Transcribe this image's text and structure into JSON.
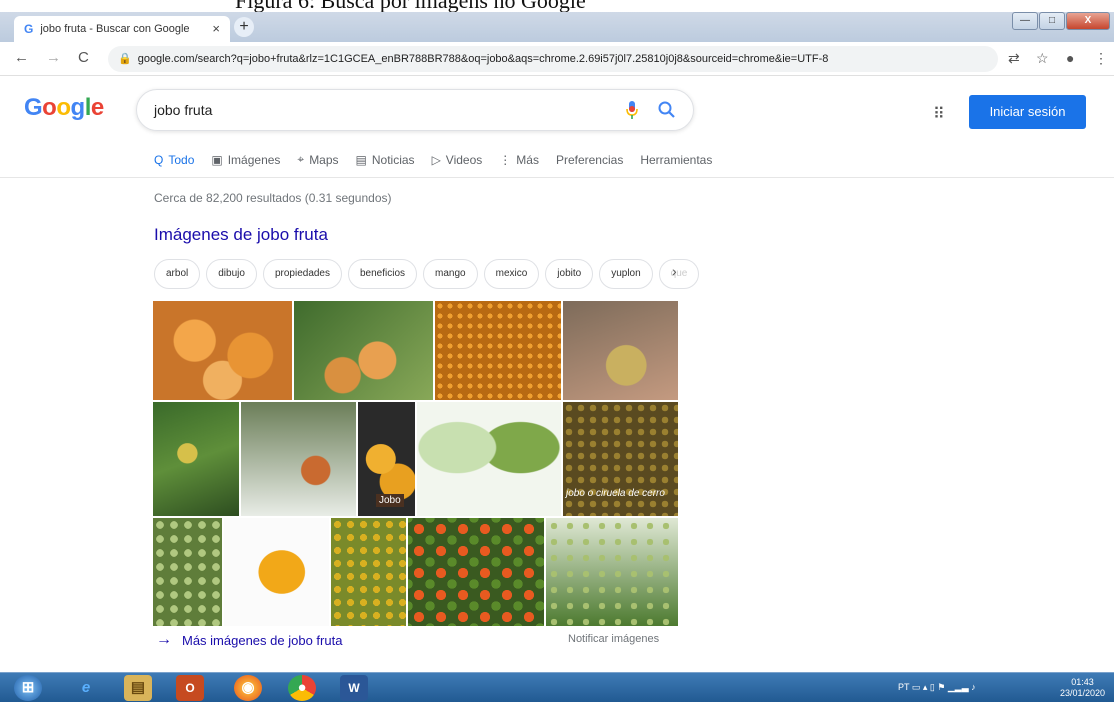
{
  "caption": "Figura 6: Busca por imagens no Google",
  "browser": {
    "tab_title": "jobo fruta - Buscar con Google",
    "tab_close": "×",
    "new_tab": "+",
    "url": "google.com/search?q=jobo+fruta&rlz=1C1GCEA_enBR788BR788&oq=jobo&aqs=chrome.2.69i57j0l7.25810j0j8&sourceid=chrome&ie=UTF-8",
    "nav": {
      "back": "←",
      "forward": "→",
      "reload": "C"
    },
    "window": {
      "min": "—",
      "max": "□",
      "close": "X"
    }
  },
  "google": {
    "logo": [
      "G",
      "o",
      "o",
      "g",
      "l",
      "e"
    ],
    "query": "jobo fruta",
    "signin": "Iniciar sesión",
    "tabs": [
      {
        "label": "Todo",
        "icon": "Q"
      },
      {
        "label": "Imágenes",
        "icon": "▣"
      },
      {
        "label": "Maps",
        "icon": "⌖"
      },
      {
        "label": "Noticias",
        "icon": "▤"
      },
      {
        "label": "Videos",
        "icon": "▷"
      },
      {
        "label": "Más",
        "icon": "⋮"
      },
      {
        "label": "Preferencias",
        "icon": ""
      },
      {
        "label": "Herramientas",
        "icon": ""
      }
    ],
    "stats": "Cerca de 82,200 resultados (0.31 segundos)",
    "images_heading": "Imágenes de jobo fruta",
    "chips": [
      "arbol",
      "dibujo",
      "propiedades",
      "beneficios",
      "mango",
      "mexico",
      "jobito",
      "yuplon",
      "que"
    ],
    "image_captions": [
      "Jobo",
      "jobo o ciruela de cerro"
    ],
    "more_images": "Más imágenes de jobo fruta",
    "report_images": "Notificar imágenes"
  },
  "taskbar": {
    "language": "PT",
    "time": "01:43",
    "date": "23/01/2020"
  },
  "colors": {
    "accent": "#1a73e8",
    "link": "#1a0dab",
    "taskbar": "#215a92"
  }
}
